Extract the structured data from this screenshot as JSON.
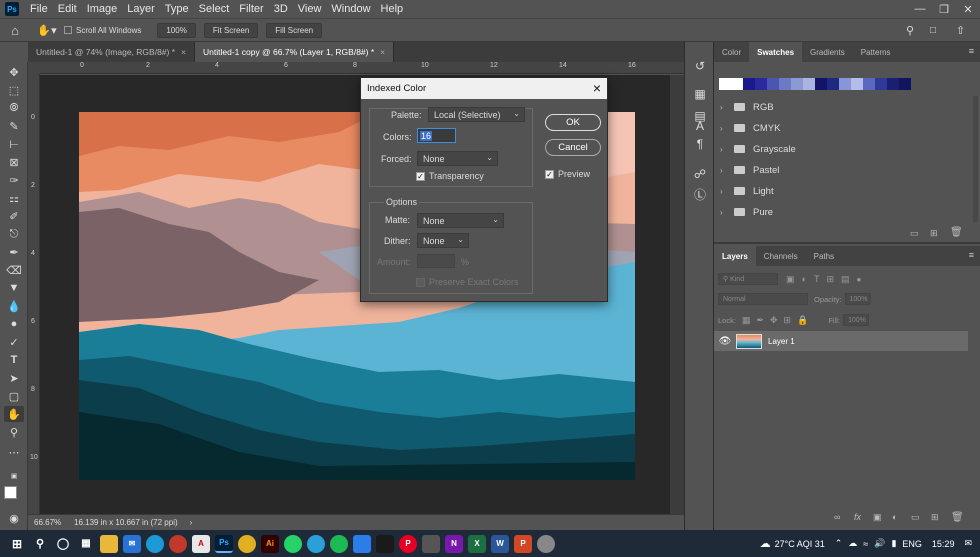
{
  "menubar": {
    "logo": "Ps",
    "items": [
      "File",
      "Edit",
      "Image",
      "Layer",
      "Type",
      "Select",
      "Filter",
      "3D",
      "View",
      "Window",
      "Help"
    ]
  },
  "options_bar": {
    "scroll_all_windows": "Scroll All Windows",
    "zoom_value": "100%",
    "fit_screen": "Fit Screen",
    "fill_screen": "Fill Screen"
  },
  "tabs": [
    {
      "label": "Untitled-1 @ 74% (Image, RGB/8#) *",
      "active": false
    },
    {
      "label": "Untitled-1 copy @ 66.7% (Layer 1, RGB/8#) *",
      "active": true
    }
  ],
  "rulers": {
    "top": [
      "0",
      "2",
      "4",
      "6",
      "8",
      "10",
      "12",
      "14",
      "16"
    ],
    "left": [
      "0",
      "2",
      "4",
      "6",
      "8",
      "10"
    ]
  },
  "status": {
    "zoom": "66.67%",
    "doc_size": "16.139 in x 10.667 in (72 ppi)"
  },
  "dialog": {
    "title": "Indexed Color",
    "palette_label": "Palette:",
    "palette_value": "Local (Selective)",
    "colors_label": "Colors:",
    "colors_value": "16",
    "forced_label": "Forced:",
    "forced_value": "None",
    "transparency_label": "Transparency",
    "options_label": "Options",
    "matte_label": "Matte:",
    "matte_value": "None",
    "dither_label": "Dither:",
    "dither_value": "None",
    "amount_label": "Amount:",
    "amount_unit": "%",
    "preserve_label": "Preserve Exact Colors",
    "ok_label": "OK",
    "cancel_label": "Cancel",
    "preview_label": "Preview"
  },
  "swatches_panel": {
    "tabs": [
      "Color",
      "Swatches",
      "Gradients",
      "Patterns"
    ],
    "active_tab": "Swatches",
    "swatch_colors": [
      "#ffffff",
      "#ffffff",
      "#1a1a8c",
      "#2a2a9e",
      "#4a56b0",
      "#6a7ac4",
      "#8c9ad4",
      "#aab4e0",
      "#141466",
      "#1e2a80",
      "#8896d8",
      "#b4bcec",
      "#5a68c0",
      "#2e3a96",
      "#1a1f70",
      "#101560"
    ],
    "folders": [
      "RGB",
      "CMYK",
      "Grayscale",
      "Pastel",
      "Light",
      "Pure"
    ]
  },
  "layers_panel": {
    "tabs": [
      "Layers",
      "Channels",
      "Paths"
    ],
    "active_tab": "Layers",
    "kind_label": "Kind",
    "blend_mode": "Normal",
    "opacity_label": "Opacity:",
    "opacity_value": "100%",
    "lock_label": "Lock:",
    "fill_label": "Fill:",
    "fill_value": "100%",
    "layers": [
      {
        "name": "Layer 1",
        "visible": true
      }
    ]
  },
  "taskbar": {
    "weather": "27°C  AQI 31",
    "language": "ENG",
    "time": "15:29"
  }
}
